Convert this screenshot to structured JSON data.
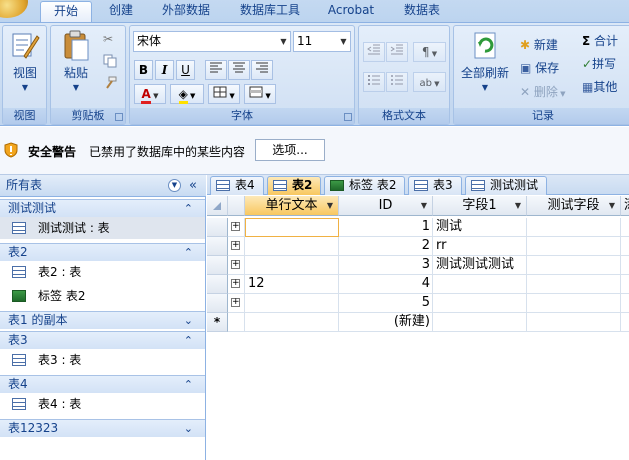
{
  "ribbon_tabs": [
    "开始",
    "创建",
    "外部数据",
    "数据库工具",
    "Acrobat",
    "数据表"
  ],
  "groups": {
    "views": {
      "label": "视图",
      "view_button": "视图"
    },
    "clipboard": {
      "label": "剪贴板",
      "paste_button": "粘贴"
    },
    "font": {
      "label": "字体",
      "font_name": "宋体",
      "font_size": "11",
      "bold": "B",
      "italic": "I",
      "underline": "U",
      "font_color": "A"
    },
    "rich_text": {
      "label": "格式文本"
    },
    "records": {
      "label": "记录",
      "refresh_all": "全部刷新",
      "new": "新建",
      "save": "保存",
      "delete": "删除",
      "totals": "合计",
      "spelling": "拼写",
      "more": "其他"
    }
  },
  "security": {
    "title": "安全警告",
    "message": "已禁用了数据库中的某些内容",
    "options_button": "选项..."
  },
  "nav": {
    "header": "所有表",
    "groups": [
      {
        "label": "测试测试",
        "chevron": "⌃"
      },
      {
        "label": "表2",
        "chevron": "⌃"
      },
      {
        "label": "表1 的副本",
        "chevron": "⌄"
      },
      {
        "label": "表3",
        "chevron": "⌃"
      },
      {
        "label": "表4",
        "chevron": "⌃"
      },
      {
        "label": "表12323",
        "chevron": "⌄"
      }
    ],
    "items": [
      "测试测试 : 表",
      "表2 : 表",
      "标签 表2",
      "表3 : 表",
      "表4 : 表"
    ]
  },
  "doc_tabs": [
    "表4",
    "表2",
    "标签 表2",
    "表3",
    "测试测试"
  ],
  "grid": {
    "columns": [
      "单行文本",
      "ID",
      "字段1",
      "测试字段",
      "添"
    ],
    "rows": [
      {
        "text": "",
        "id": "1",
        "field1": "测试",
        "test": ""
      },
      {
        "text": "",
        "id": "2",
        "field1": "rr",
        "test": ""
      },
      {
        "text": "",
        "id": "3",
        "field1": "测试测试测试",
        "test": ""
      },
      {
        "text": "12",
        "id": "4",
        "field1": "",
        "test": ""
      },
      {
        "text": "",
        "id": "5",
        "field1": "",
        "test": ""
      }
    ],
    "new_row_marker": "*",
    "new_row_label": "(新建)"
  }
}
